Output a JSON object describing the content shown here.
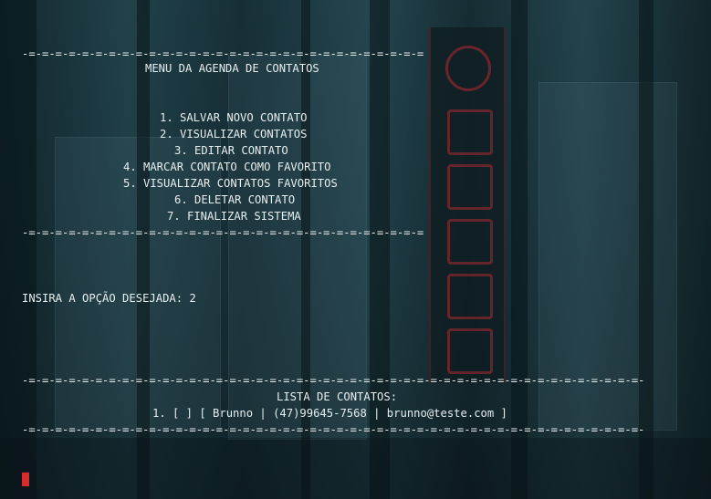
{
  "terminal": {
    "separator_short": "-=-=-=-=-=-=-=-=-=-=-=-=-=-=-=-=-=-=-=-=-=-=-=-=-=-=-=-=-=-=",
    "menu_title": "MENU DA AGENDA DE CONTATOS",
    "menu_items": [
      "1. SALVAR NOVO CONTATO",
      "2. VISUALIZAR CONTATOS",
      "3. EDITAR CONTATO",
      "4. MARCAR CONTATO COMO FAVORITO",
      "5. VISUALIZAR CONTATOS FAVORITOS",
      "6. DELETAR CONTATO",
      "7. FINALIZAR SISTEMA"
    ],
    "prompt_label": "INSIRA A OPÇÃO DESEJADA:",
    "prompt_value": "2",
    "separator_long": "-=-=-=-=-=-=-=-=-=-=-=-=-=-=-=-=-=-=-=-=-=-=-=-=-=-=-=-=-=-=-=-=-=-=-=-=-=-=-=-=-=-=-=-=-=-=-",
    "list_title": "LISTA DE CONTATOS:",
    "contacts": [
      "1. [ ] [ Brunno | (47)99645-7568 | brunno@teste.com ]"
    ]
  },
  "colors": {
    "text": "#e6eef0",
    "cursor": "#d62c2c",
    "background": "#1d3a42",
    "neon_accent": "#b42832"
  }
}
